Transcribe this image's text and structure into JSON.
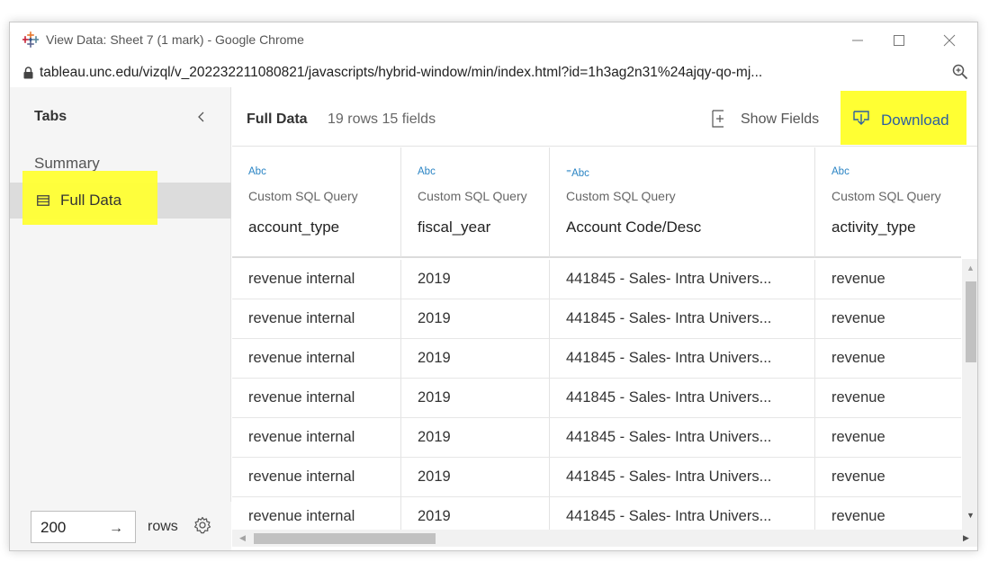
{
  "window": {
    "title": "View Data: Sheet 7 (1 mark) - Google Chrome",
    "url": "tableau.unc.edu/vizql/v_202232211080821/javascripts/hybrid-window/min/index.html?id=1h3ag2n31%24ajqy-qo-mj...",
    "controls": [
      "minimize-icon",
      "maximize-icon",
      "close-icon"
    ]
  },
  "sidebar": {
    "header": "Tabs",
    "collapse_icon": "chevron-left-icon",
    "items": [
      {
        "label": "Summary",
        "selected": false
      },
      {
        "label": "Full Data",
        "selected": true,
        "icon": "table-icon"
      }
    ],
    "footer": {
      "rows_value": "200",
      "arrow": "→",
      "rows_label": "rows",
      "settings_icon": "gear-icon"
    }
  },
  "toolbar": {
    "title": "Full Data",
    "meta": "19 rows 15 fields",
    "show_fields_label": "Show Fields",
    "download_label": "Download",
    "highlight_color": "#ffff33"
  },
  "table": {
    "columns": [
      {
        "type": "Abc",
        "source": "Custom SQL Query",
        "name": "account_type"
      },
      {
        "type": "Abc",
        "source": "Custom SQL Query",
        "name": "fiscal_year"
      },
      {
        "type": "⁼Abc",
        "source": "Custom SQL Query",
        "name": "Account Code/Desc"
      },
      {
        "type": "Abc",
        "source": "Custom SQL Query",
        "name": "activity_type"
      }
    ],
    "rows": [
      [
        "revenue internal",
        "2019",
        "441845 - Sales- Intra Univers...",
        "revenue"
      ],
      [
        "revenue internal",
        "2019",
        "441845 - Sales- Intra Univers...",
        "revenue"
      ],
      [
        "revenue internal",
        "2019",
        "441845 - Sales- Intra Univers...",
        "revenue"
      ],
      [
        "revenue internal",
        "2019",
        "441845 - Sales- Intra Univers...",
        "revenue"
      ],
      [
        "revenue internal",
        "2019",
        "441845 - Sales- Intra Univers...",
        "revenue"
      ],
      [
        "revenue internal",
        "2019",
        "441845 - Sales- Intra Univers...",
        "revenue"
      ],
      [
        "revenue internal",
        "2019",
        "441845 - Sales- Intra Univers...",
        "revenue"
      ]
    ]
  },
  "colors": {
    "accent": "#2a84c4",
    "link": "#2d5fa0",
    "highlight": "#ffff33"
  }
}
